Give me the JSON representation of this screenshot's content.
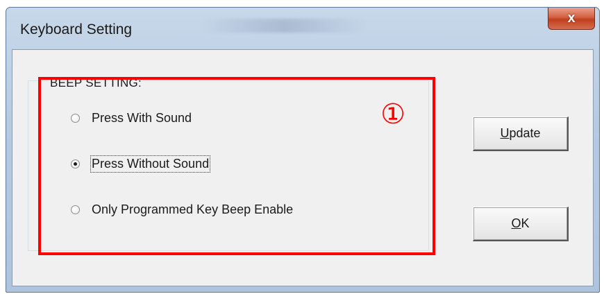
{
  "window": {
    "title": "Keyboard Setting",
    "close_label": "x"
  },
  "beep_setting": {
    "group_label": "BEEP SETTING:",
    "options": [
      {
        "label": "Press With Sound",
        "selected": false
      },
      {
        "label": "Press Without Sound",
        "selected": true
      },
      {
        "label": "Only Programmed Key Beep Enable",
        "selected": false
      }
    ]
  },
  "buttons": {
    "update_first": "U",
    "update_rest": "pdate",
    "ok_first": "O",
    "ok_rest": "K"
  },
  "annotation": {
    "marker": "①",
    "color": "#ff0000"
  }
}
